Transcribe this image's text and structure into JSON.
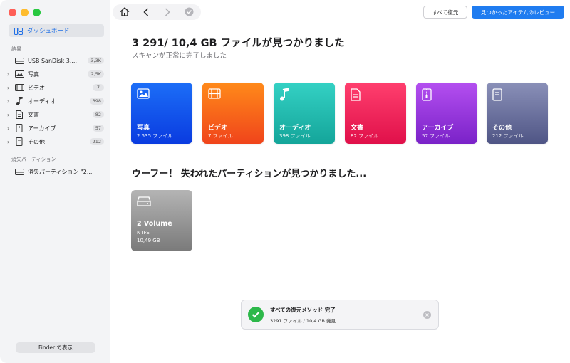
{
  "sidebar": {
    "dashboard_label": "ダッシュボード",
    "results_title": "結果",
    "items": [
      {
        "label": "USB  SanDisk 3....",
        "badge": "3,3K",
        "icon": "drive-icon"
      },
      {
        "label": "写真",
        "badge": "2,5K",
        "icon": "photo-icon"
      },
      {
        "label": "ビデオ",
        "badge": "7",
        "icon": "video-icon"
      },
      {
        "label": "オーディオ",
        "badge": "398",
        "icon": "music-icon"
      },
      {
        "label": "文書",
        "badge": "82",
        "icon": "document-icon"
      },
      {
        "label": "アーカイブ",
        "badge": "57",
        "icon": "archive-icon"
      },
      {
        "label": "その他",
        "badge": "212",
        "icon": "other-icon"
      }
    ],
    "lost_partition_title": "消失パーティション",
    "lost_partition_item": "消失パーティション \"2...",
    "finder_button": "Finder で表示"
  },
  "toolbar": {
    "recover_all": "すべて復元",
    "review_found": "見つかったアイテムのレビュー"
  },
  "main": {
    "headline": "3 291/ 10,4 GB ファイルが見つかりました",
    "subline": "スキャンが正常に完了しました",
    "categories": [
      {
        "title": "写真",
        "count": "2 535 ファイル",
        "color_top": "#1c6ef7",
        "color_bottom": "#0a3be0",
        "icon": "photo-icon"
      },
      {
        "title": "ビデオ",
        "count": "7 ファイル",
        "color_top": "#ff8a1a",
        "color_bottom": "#f0441b",
        "icon": "film-icon"
      },
      {
        "title": "オーディオ",
        "count": "398 ファイル",
        "color_top": "#34d1c4",
        "color_bottom": "#14a59a",
        "icon": "music-note-icon"
      },
      {
        "title": "文書",
        "count": "82 ファイル",
        "color_top": "#ff3f6e",
        "color_bottom": "#e0104a",
        "icon": "document-icon"
      },
      {
        "title": "アーカイブ",
        "count": "57 ファイル",
        "color_top": "#b44ff0",
        "color_bottom": "#7a22c8",
        "icon": "archive-icon"
      },
      {
        "title": "その他",
        "count": "212 ファイル",
        "color_top": "#8a90b8",
        "color_bottom": "#4f5585",
        "icon": "file-icon"
      }
    ],
    "section2_title": "ウーフー！ 失われたパーティションが見つかりました...",
    "volume": {
      "title": "2 Volume",
      "fs": "NTFS",
      "size": "10,49 GB"
    }
  },
  "toast": {
    "title": "すべての復元メソッド 完了",
    "subtitle": "3291 ファイル / 10,4 GB 発見"
  }
}
